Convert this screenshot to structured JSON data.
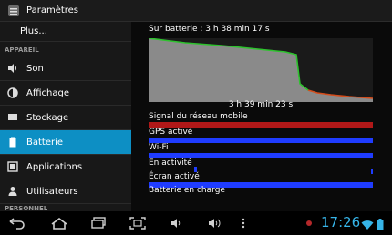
{
  "window": {
    "title": "Paramètres",
    "icon": "settings-icon"
  },
  "sidebar": {
    "top_item": {
      "label": "Plus..."
    },
    "section_header": "APPAREIL",
    "items": [
      {
        "label": "Son",
        "icon": "volume-icon",
        "active": false
      },
      {
        "label": "Affichage",
        "icon": "brightness-icon",
        "active": false
      },
      {
        "label": "Stockage",
        "icon": "storage-icon",
        "active": false
      },
      {
        "label": "Batterie",
        "icon": "battery-icon",
        "active": true
      },
      {
        "label": "Applications",
        "icon": "apps-icon",
        "active": false
      },
      {
        "label": "Utilisateurs",
        "icon": "users-icon",
        "active": false
      }
    ],
    "bottom_header": "PERSONNEL"
  },
  "battery_detail": {
    "on_battery_label": "Sur batterie : 3 h 38 min 17 s",
    "graph_time_label": "3 h 39 min 23 s",
    "signals": [
      {
        "label": "Signal du réseau mobile",
        "color": "#b01818"
      },
      {
        "label": "GPS activé",
        "color": "#1f3cff"
      },
      {
        "label": "Wi-Fi",
        "color": "#1f3cff"
      },
      {
        "label": "En activité",
        "color": "#1f3cff"
      },
      {
        "label": "Écran activé",
        "color": "#1f3cff"
      },
      {
        "label": "Batterie en charge",
        "color": "#1f3cff"
      }
    ]
  },
  "navigation": {
    "buttons": [
      "back-icon",
      "home-icon",
      "recent-apps-icon",
      "screenshot-icon",
      "volume-down-icon",
      "volume-up-icon",
      "menu-icon"
    ]
  },
  "status": {
    "clock": "17:26",
    "icons": [
      "notification-icon",
      "wifi-icon",
      "battery-status-icon"
    ]
  },
  "colors": {
    "accent": "#0d8fc4",
    "clock": "#36b4e8",
    "graph_fill": "#8a8a8a",
    "graph_line_full": "#2ec22e",
    "graph_line_low": "#d44c1a"
  }
}
